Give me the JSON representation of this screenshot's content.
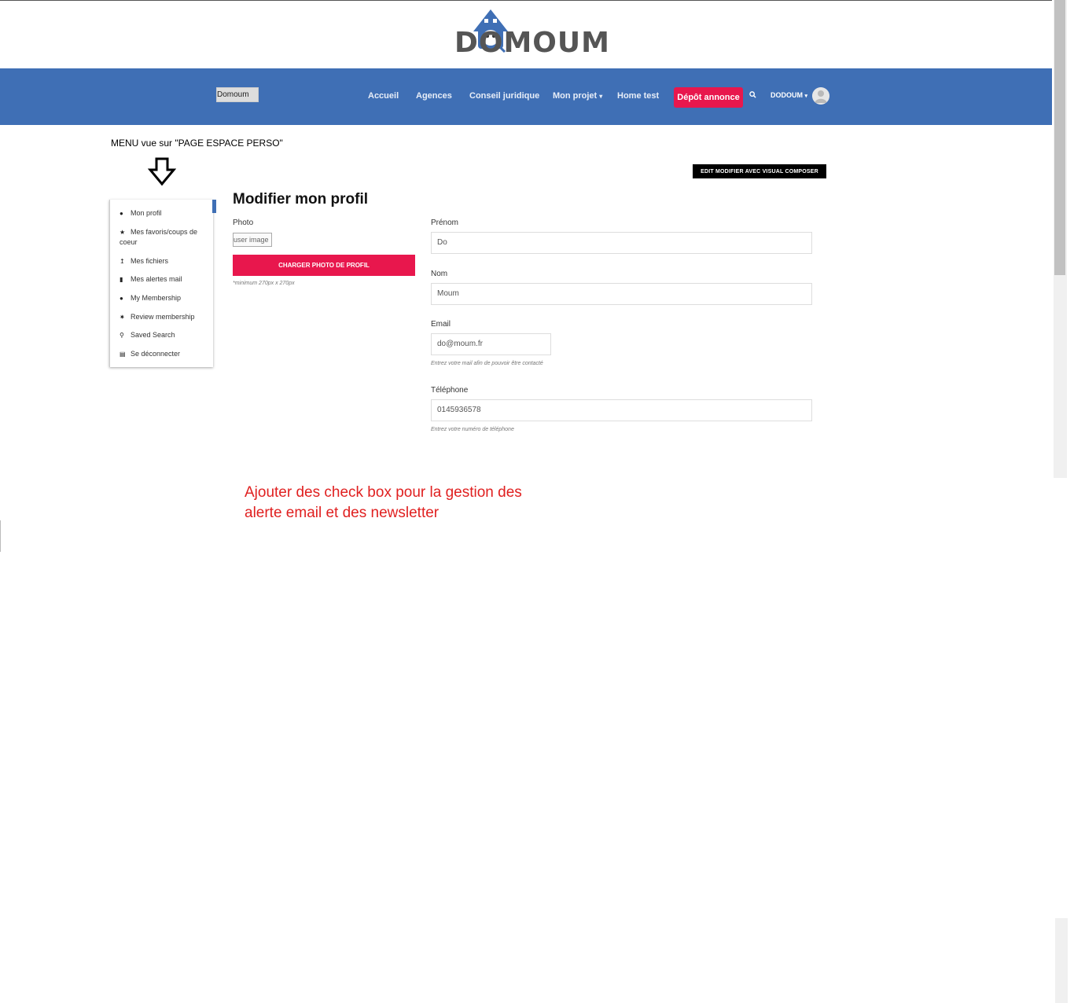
{
  "brand": {
    "logo_text": "DOMOUM",
    "nav_logo_alt": "Domoum"
  },
  "nav": {
    "items": [
      "Accueil",
      "Agences",
      "Conseil juridique",
      "Mon projet",
      "Home test"
    ],
    "depot_label": "Dépôt annonce",
    "user_label": "DODOUM",
    "accent_color": "#3f6fb5",
    "cta_color": "#e8174d"
  },
  "annotations": {
    "menu_note": "MENU vue sur \"PAGE ESPACE PERSO\"",
    "red_note_line1": "Ajouter des check box pour la gestion des",
    "red_note_line2": "alerte email et des newsletter"
  },
  "toolbar": {
    "vc_label": "EDIT  MODIFIER AVEC VISUAL COMPOSER"
  },
  "menu": {
    "items": [
      {
        "label": "Mon profil",
        "icon": "user-icon"
      },
      {
        "label": "Mes favoris/coups de coeur",
        "icon": "star-icon"
      },
      {
        "label": "Mes fichiers",
        "icon": "upload-icon"
      },
      {
        "label": "Mes alertes mail",
        "icon": "building-icon"
      },
      {
        "label": "My Membership",
        "icon": "user-icon"
      },
      {
        "label": "Review membership",
        "icon": "badge-icon"
      },
      {
        "label": "Saved Search",
        "icon": "search-icon"
      },
      {
        "label": "Se déconnecter",
        "icon": "unlock-icon"
      }
    ]
  },
  "profile": {
    "title": "Modifier mon profil",
    "photo_label": "Photo",
    "photo_alt": "user image",
    "upload_button": "CHARGER PHOTO DE PROFIL",
    "upload_hint": "*minimum 270px x 270px",
    "prenom_label": "Prénom",
    "prenom_value": "Do",
    "nom_label": "Nom",
    "nom_value": "Moum",
    "email_label": "Email",
    "email_value": "do@moum.fr",
    "email_hint": "Entrez votre mail afin de pouvoir être contacté",
    "tel_label": "Téléphone",
    "tel_value": "0145936578",
    "tel_hint": "Entrez votre numéro de téléphone"
  }
}
